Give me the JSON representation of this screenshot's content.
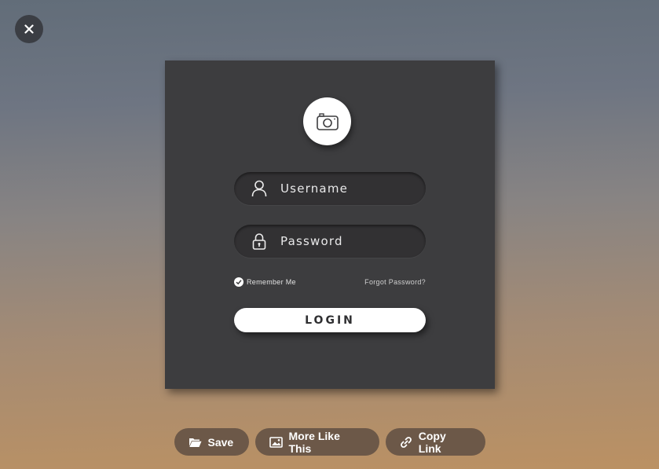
{
  "overlay": {
    "close_icon": "close-icon"
  },
  "login_card": {
    "avatar_icon": "camera-icon",
    "username": {
      "icon": "user-icon",
      "placeholder": "Username"
    },
    "password": {
      "icon": "lock-icon",
      "placeholder": "Password"
    },
    "remember_me": {
      "label": "Remember Me",
      "checked": true
    },
    "forgot_password": "Forgot Password?",
    "login_label": "LOGIN"
  },
  "actions": [
    {
      "label": "Save",
      "icon": "folder-icon"
    },
    {
      "label": "More Like This",
      "icon": "image-icon"
    },
    {
      "label": "Copy Link",
      "icon": "link-icon"
    }
  ],
  "colors": {
    "card": "#3d3d3f",
    "field": "#323133",
    "pill": "#6c5848",
    "close_button": "#3b3e44"
  }
}
